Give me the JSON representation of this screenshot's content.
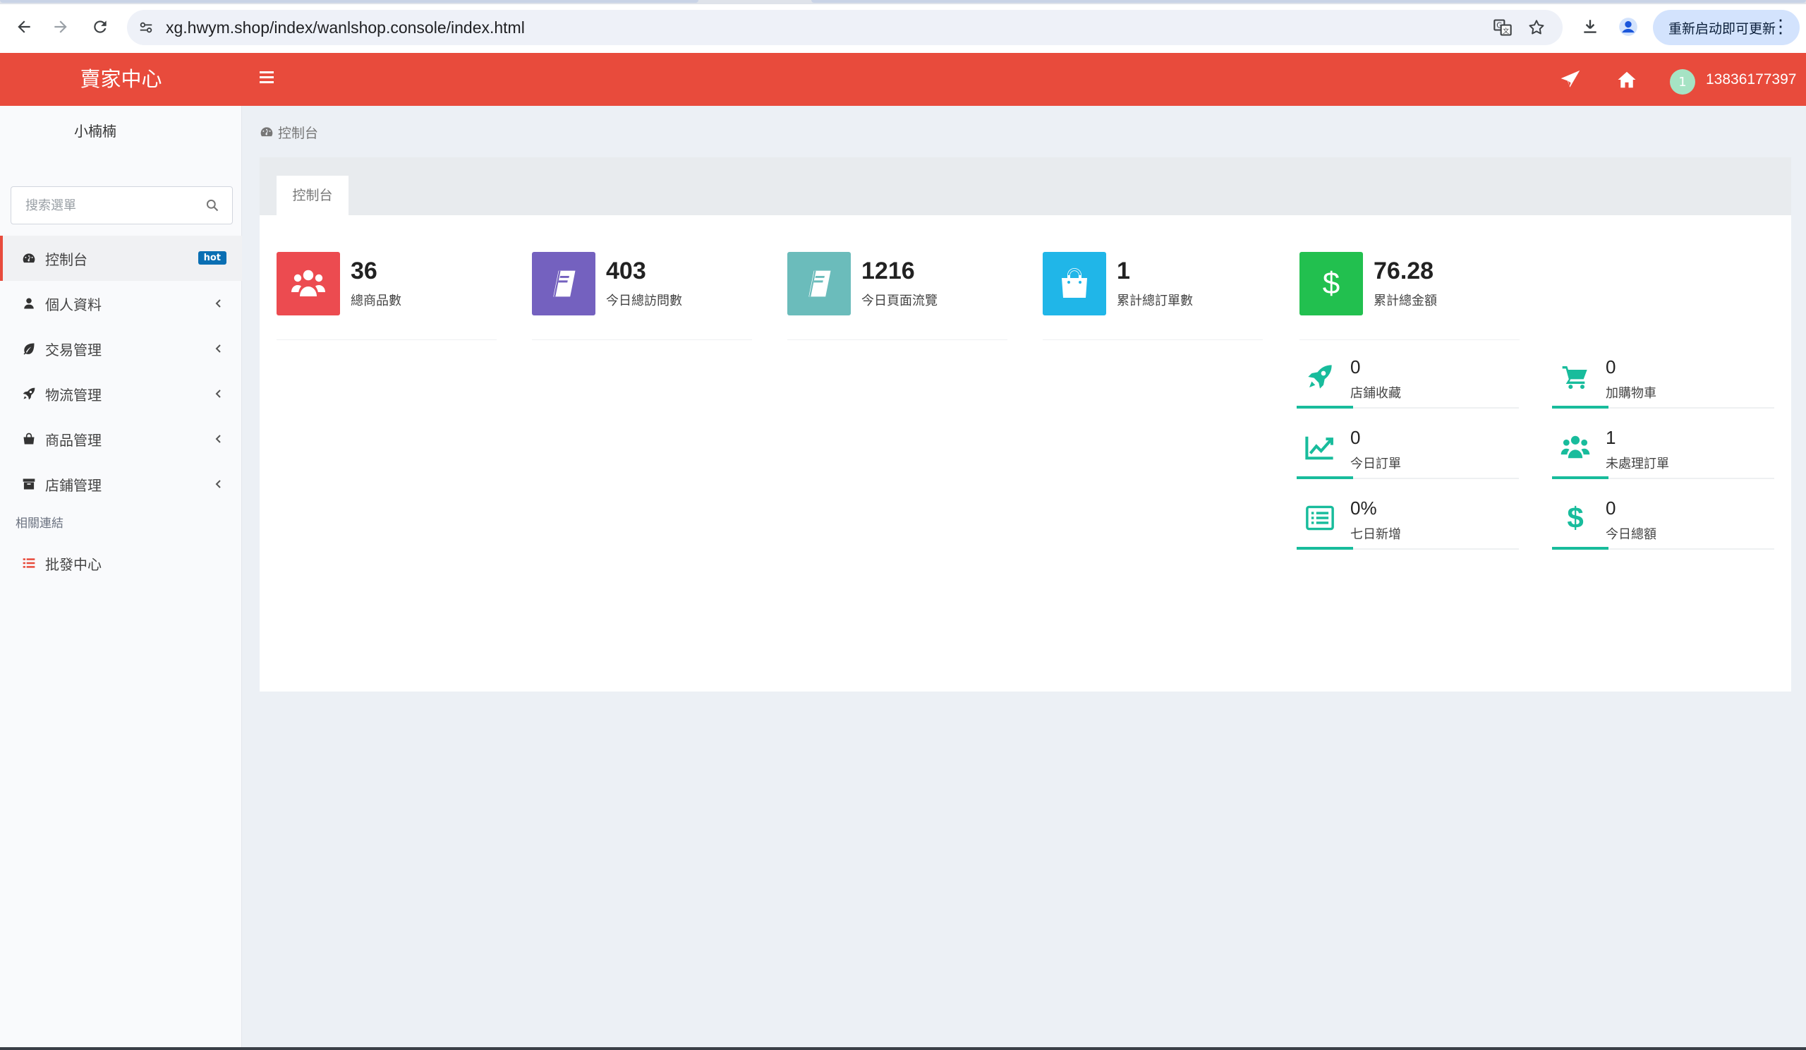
{
  "browser": {
    "url": "xg.hwym.shop/index/wanlshop.console/index.html",
    "update_button": "重新启动即可更新"
  },
  "header": {
    "logo": "賣家中心",
    "user_avatar_initial": "1",
    "username": "13836177397",
    "accent_color": "#e84b3c"
  },
  "sidebar": {
    "user_name": "小楠楠",
    "search_placeholder": "搜索選單",
    "items": [
      {
        "label": "控制台",
        "icon": "dashboard-icon",
        "badge": "hot",
        "active": true
      },
      {
        "label": "個人資料",
        "icon": "user-icon"
      },
      {
        "label": "交易管理",
        "icon": "leaf-icon"
      },
      {
        "label": "物流管理",
        "icon": "rocket-icon"
      },
      {
        "label": "商品管理",
        "icon": "shopping-bag-icon"
      },
      {
        "label": "店鋪管理",
        "icon": "archive-icon"
      }
    ],
    "section_header": "相關連結",
    "links": [
      {
        "label": "批發中心",
        "icon": "list-icon"
      }
    ]
  },
  "breadcrumb": {
    "label": "控制台"
  },
  "panel": {
    "tab": "控制台",
    "stats": [
      {
        "value": "36",
        "label": "總商品數",
        "color": "#ec4b50",
        "icon": "users-icon"
      },
      {
        "value": "403",
        "label": "今日總訪問數",
        "color": "#7461bf",
        "icon": "book-icon"
      },
      {
        "value": "1216",
        "label": "今日頁面流覽",
        "color": "#6bbcbb",
        "icon": "book-icon"
      },
      {
        "value": "1",
        "label": "累計總訂單數",
        "color": "#20b6e8",
        "icon": "shopping-bag-icon"
      },
      {
        "value": "76.28",
        "label": "累計總金額",
        "color": "#22c04f",
        "icon": "dollar-icon"
      }
    ],
    "mini_stats": [
      {
        "value": "0",
        "label": "店鋪收藏",
        "icon": "rocket-icon"
      },
      {
        "value": "0",
        "label": "加購物車",
        "icon": "cart-icon"
      },
      {
        "value": "0",
        "label": "今日訂單",
        "icon": "line-chart-icon"
      },
      {
        "value": "1",
        "label": "未處理訂單",
        "icon": "users-icon"
      },
      {
        "value": "0%",
        "label": "七日新增",
        "icon": "list-alt-icon"
      },
      {
        "value": "0",
        "label": "今日總額",
        "icon": "dollar-icon"
      }
    ],
    "mini_color": "#18bc9c"
  }
}
